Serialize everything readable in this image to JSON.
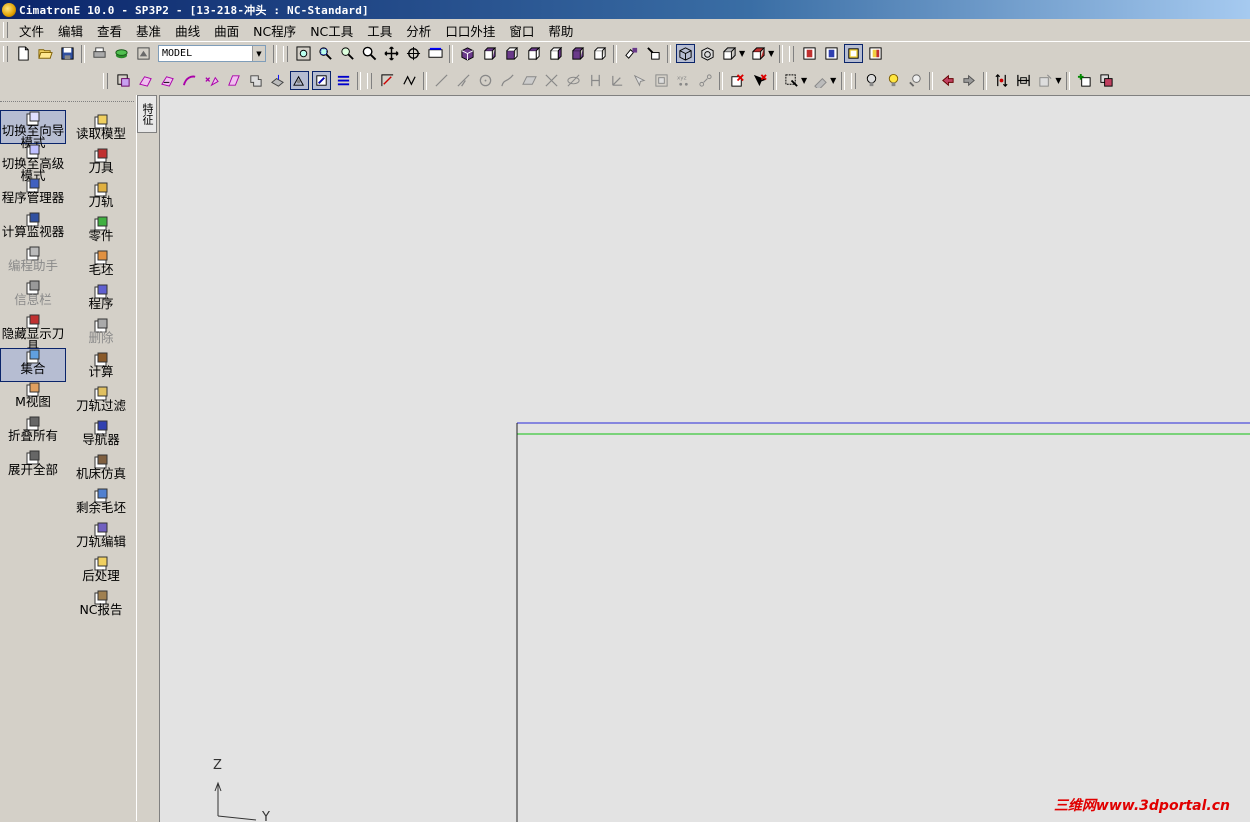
{
  "window": {
    "title": "CimatronE 10.0 - SP3P2 - [13-218-冲头 : NC-Standard]"
  },
  "menu": [
    "文件",
    "编辑",
    "查看",
    "基准",
    "曲线",
    "曲面",
    "NC程序",
    "NC工具",
    "工具",
    "分析",
    "口口外挂",
    "窗口",
    "帮助"
  ],
  "toolbar": {
    "model_combo": "MODEL"
  },
  "side_tab": {
    "label": "特征"
  },
  "left_panel": [
    {
      "label": "切换至向导模式",
      "icon": "wizard-mode-icon",
      "state": "active"
    },
    {
      "label": "切换至高级模式",
      "icon": "advanced-mode-icon",
      "state": "normal"
    },
    {
      "label": "程序管理器",
      "icon": "program-manager-icon",
      "state": "normal"
    },
    {
      "label": "计算监视器",
      "icon": "compute-monitor-icon",
      "state": "normal"
    },
    {
      "label": "编程助手",
      "icon": "help-icon",
      "state": "disabled"
    },
    {
      "label": "信息栏",
      "icon": "info-icon",
      "state": "disabled"
    },
    {
      "label": "隐藏显示刀具",
      "icon": "tool-visibility-icon",
      "state": "normal"
    },
    {
      "label": "集合",
      "icon": "collection-icon",
      "state": "active"
    },
    {
      "label": "M视图",
      "icon": "m-view-icon",
      "state": "normal"
    },
    {
      "label": "折叠所有",
      "icon": "collapse-icon",
      "state": "normal"
    },
    {
      "label": "展开全部",
      "icon": "expand-icon",
      "state": "normal"
    }
  ],
  "nc_panel": [
    {
      "label": "读取模型",
      "icon": "load-model-icon",
      "state": "normal"
    },
    {
      "label": "刀具",
      "icon": "tool-icon",
      "state": "normal"
    },
    {
      "label": "刀轨",
      "icon": "toolpath-icon",
      "state": "normal"
    },
    {
      "label": "零件",
      "icon": "part-icon",
      "state": "normal"
    },
    {
      "label": "毛坯",
      "icon": "stock-icon",
      "state": "normal"
    },
    {
      "label": "程序",
      "icon": "procedure-icon",
      "state": "normal"
    },
    {
      "label": "删除",
      "icon": "delete-icon",
      "state": "disabled"
    },
    {
      "label": "计算",
      "icon": "execute-icon",
      "state": "normal"
    },
    {
      "label": "刀轨过滤",
      "icon": "toolpath-filter-icon",
      "state": "normal"
    },
    {
      "label": "导航器",
      "icon": "navigator-icon",
      "state": "normal"
    },
    {
      "label": "机床仿真",
      "icon": "machine-sim-icon",
      "state": "normal"
    },
    {
      "label": "剩余毛坯",
      "icon": "remaining-stock-icon",
      "state": "normal"
    },
    {
      "label": "刀轨编辑",
      "icon": "toolpath-edit-icon",
      "state": "normal"
    },
    {
      "label": "后处理",
      "icon": "post-process-icon",
      "state": "normal"
    },
    {
      "label": "NC报告",
      "icon": "nc-report-icon",
      "state": "normal"
    }
  ],
  "axis": {
    "z": "Z",
    "y": "Y"
  },
  "watermark": "三维网www.3dportal.cn",
  "colors": {
    "edge_blue": "#2a2ad8",
    "edge_green": "#10c010",
    "edge_dark": "#202020"
  }
}
